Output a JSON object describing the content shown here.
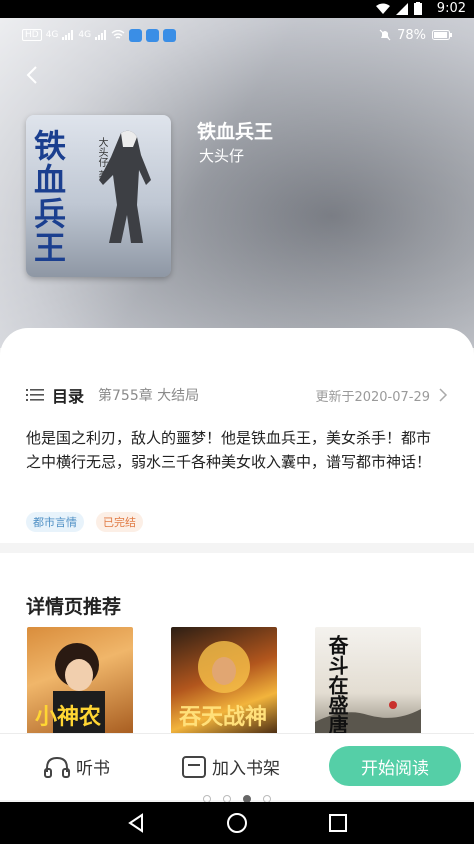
{
  "system_status": {
    "time": "9:02"
  },
  "inner_status": {
    "net1": "4G",
    "net2": "4G",
    "battery": "78%"
  },
  "book": {
    "title": "铁血兵王",
    "author": "大头仔",
    "cover_title": "铁血兵王",
    "cover_author": "大头仔 著"
  },
  "toc": {
    "label": "目录",
    "latest_chapter": "第755章 大结局",
    "updated": "更新于2020-07-29"
  },
  "description": "他是国之利刃，敌人的噩梦！他是铁血兵王，美女杀手！都市之中横行无忌，弱水三千各种美女收入囊中，谱写都市神话！",
  "tags": [
    "都市言情",
    "已完结"
  ],
  "recommend": {
    "title": "详情页推荐",
    "books": [
      {
        "cover_text": "小神农"
      },
      {
        "cover_text": "吞天战神"
      },
      {
        "cover_text": "奋斗在盛唐"
      }
    ]
  },
  "bottom_bar": {
    "listen_label": "听书",
    "shelf_label": "加入书架",
    "start_label": "开始阅读"
  },
  "colors": {
    "accent": "#55cfa7",
    "tag_blue": "#4e8fc4",
    "tag_orange": "#e07a43"
  }
}
